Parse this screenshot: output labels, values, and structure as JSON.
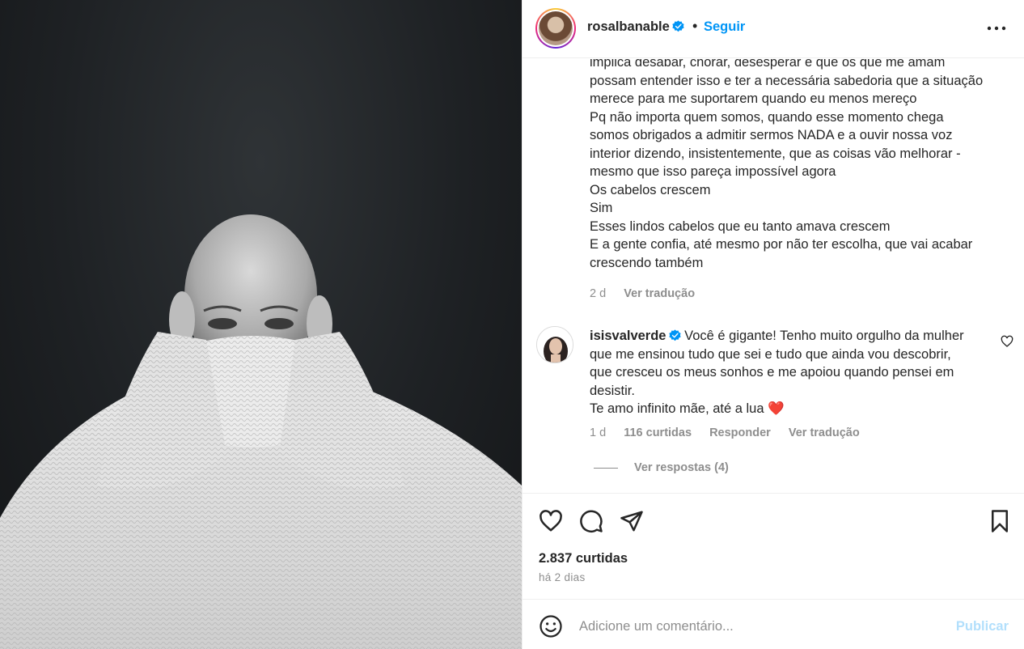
{
  "post": {
    "username": "rosalbanable",
    "separator": "•",
    "follow_label": "Seguir",
    "more_icon": "more-horizontal-icon"
  },
  "caption": {
    "lines": [
      "implica desabar, chorar, desesperar e que os que me amam",
      "possam entender isso e ter a necessária sabedoria que a situação",
      "merece para me suportarem quando eu menos mereço",
      "Pq não importa quem somos, quando esse momento chega",
      "somos obrigados a admitir sermos NADA e a ouvir nossa voz",
      "interior dizendo, insistentemente, que as coisas vão melhorar -",
      "mesmo que isso pareça impossível agora",
      "Os cabelos crescem",
      "Sim",
      "Esses lindos cabelos que eu tanto amava crescem",
      "E a gente confia, até mesmo por não ter escolha, que vai acabar",
      "crescendo também"
    ],
    "time": "2 d",
    "translate_label": "Ver tradução"
  },
  "comment": {
    "username": "isisvalverde",
    "lines": [
      "Você é gigante! Tenho muito orgulho da mulher",
      "que me ensinou tudo que sei e tudo que ainda vou descobrir,",
      "que cresceu os meus sonhos e me apoiou quando pensei em",
      "desistir.",
      "Te amo infinito mãe, até a lua"
    ],
    "emoji": "❤️",
    "time": "1 d",
    "likes": "116 curtidas",
    "reply_label": "Responder",
    "translate_label": "Ver tradução",
    "view_replies": "Ver respostas (4)"
  },
  "actions": {
    "likes": "2.837 curtidas",
    "date": "há 2 dias"
  },
  "add_comment": {
    "placeholder": "Adicione um comentário...",
    "publish_label": "Publicar"
  },
  "colors": {
    "accent": "#0095f6",
    "publish_disabled": "#b2dffc",
    "secondary_text": "#8e8e8e",
    "verified": "#0095f6",
    "heart": "#ed4956"
  }
}
